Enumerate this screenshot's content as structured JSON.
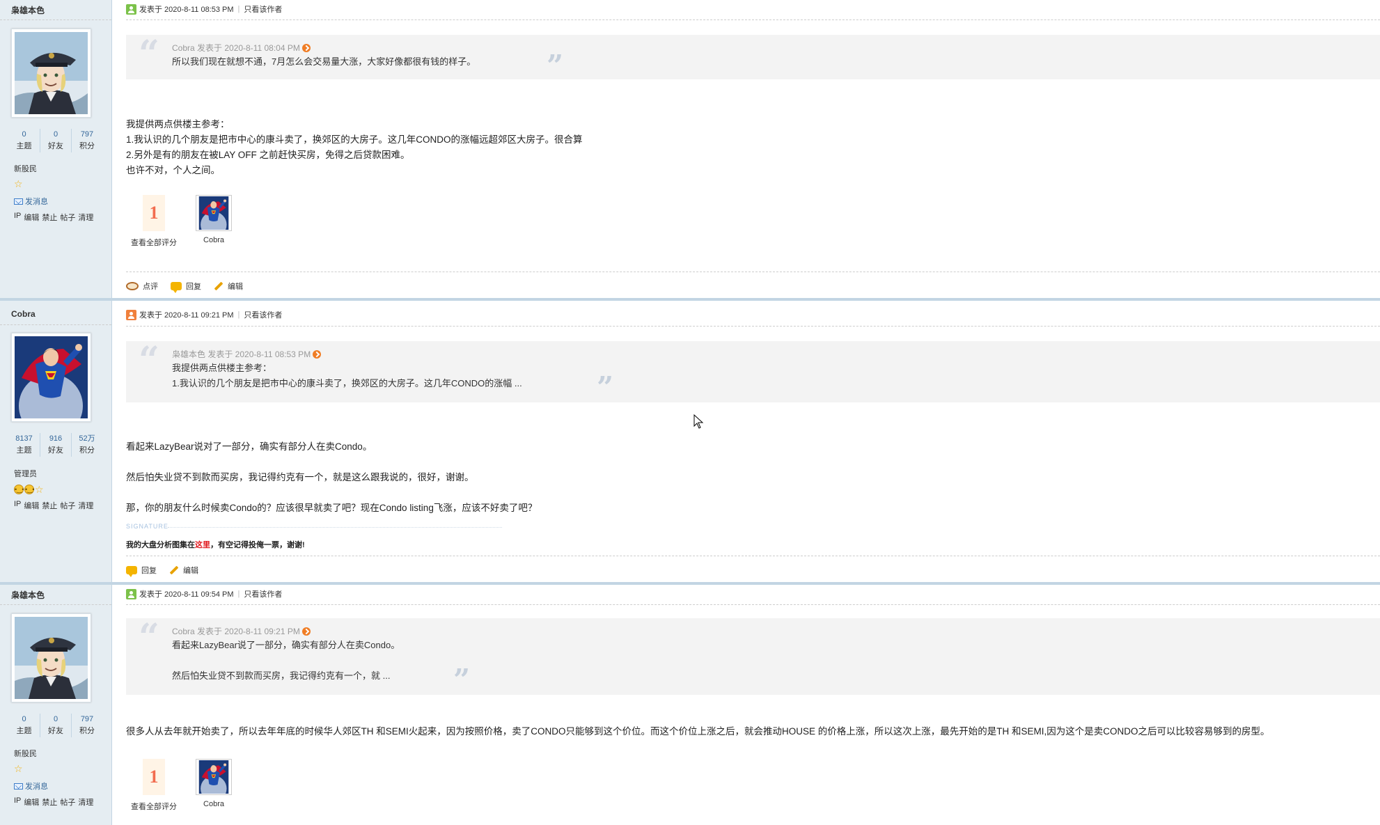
{
  "posts": [
    {
      "author": "枭雄本色",
      "avatar_kind": "officer",
      "online": "green",
      "stats": [
        {
          "num": "0",
          "label": "主题"
        },
        {
          "num": "0",
          "label": "好友"
        },
        {
          "num": "797",
          "label": "积分"
        }
      ],
      "rank": "新股民",
      "stars": 1,
      "send_message": "发消息",
      "admin_links": [
        "IP",
        "编辑",
        "禁止",
        "帖子",
        "清理"
      ],
      "posted_at": "发表于 2020-8-11 08:53 PM",
      "only_author": "只看该作者",
      "quote": {
        "head": "Cobra 发表于 2020-8-11 08:04 PM",
        "lines": [
          "所以我们现在就想不通，7月怎么会交易量大涨，大家好像都很有钱的样子。"
        ]
      },
      "body": [
        "我提供两点供楼主参考：",
        "1.我认识的几个朋友是把市中心的康斗卖了，换郊区的大房子。这几年CONDO的涨幅远超郊区大房子。很合算",
        "2.另外是有的朋友在被LAY OFF 之前赶快买房，免得之后贷款困难。",
        "也许不对，个人之间。"
      ],
      "rating": {
        "count": "1",
        "label": "查看全部评分",
        "user": "Cobra"
      },
      "actions": {
        "comment": "点评",
        "reply": "回复",
        "edit": "编辑"
      }
    },
    {
      "author": "Cobra",
      "avatar_kind": "hero",
      "online": "orange",
      "stats": [
        {
          "num": "8137",
          "label": "主题"
        },
        {
          "num": "916",
          "label": "好友"
        },
        {
          "num": "52万",
          "label": "积分"
        }
      ],
      "rank": "管理员",
      "admin_links": [
        "IP",
        "编辑",
        "禁止",
        "帖子",
        "清理"
      ],
      "posted_at": "发表于 2020-8-11 09:21 PM",
      "only_author": "只看该作者",
      "quote": {
        "head": "枭雄本色 发表于 2020-8-11 08:53 PM",
        "lines": [
          "我提供两点供楼主参考：",
          "1.我认识的几个朋友是把市中心的康斗卖了，换郊区的大房子。这几年CONDO的涨幅 ..."
        ]
      },
      "body": [
        "看起来LazyBear说对了一部分，确实有部分人在卖Condo。",
        "然后怕失业贷不到款而买房，我记得约克有一个，就是这么跟我说的，很好，谢谢。",
        "那，你的朋友什么时候卖Condo的？应该很早就卖了吧？现在Condo listing飞涨，应该不好卖了吧？"
      ],
      "signature_label": "SIGNATURE",
      "signature": {
        "pre": "我的大盘分析图集在",
        "link": "这里",
        "post": "，有空记得投俺一票，谢谢!"
      },
      "actions": {
        "reply": "回复",
        "edit": "编辑"
      }
    },
    {
      "author": "枭雄本色",
      "avatar_kind": "officer",
      "online": "green",
      "stats": [
        {
          "num": "0",
          "label": "主题"
        },
        {
          "num": "0",
          "label": "好友"
        },
        {
          "num": "797",
          "label": "积分"
        }
      ],
      "rank": "新股民",
      "stars": 1,
      "send_message": "发消息",
      "admin_links": [
        "IP",
        "编辑",
        "禁止",
        "帖子",
        "清理"
      ],
      "posted_at": "发表于 2020-8-11 09:54 PM",
      "only_author": "只看该作者",
      "quote": {
        "head": "Cobra 发表于 2020-8-11 09:21 PM",
        "lines": [
          "看起来LazyBear说了一部分，确实有部分人在卖Condo。",
          "",
          "然后怕失业贷不到款而买房，我记得约克有一个，就 ..."
        ]
      },
      "body": [
        "很多人从去年就开始卖了，所以去年年底的时候华人郊区TH 和SEMI火起来，因为按照价格，卖了CONDO只能够到这个价位。而这个价位上涨之后，就会推动HOUSE 的价格上涨，所以这次上涨，最先开始的是TH 和SEMI,因为这个是卖CONDO之后可以比较容易够到的房型。"
      ],
      "rating": {
        "count": "1",
        "label": "查看全部评分",
        "user": "Cobra"
      }
    }
  ],
  "colors": {
    "sidebar_bg": "#e5edf2",
    "link_blue": "#336699",
    "rate_red": "#f26c4f",
    "signature_link": "#e0161b"
  }
}
